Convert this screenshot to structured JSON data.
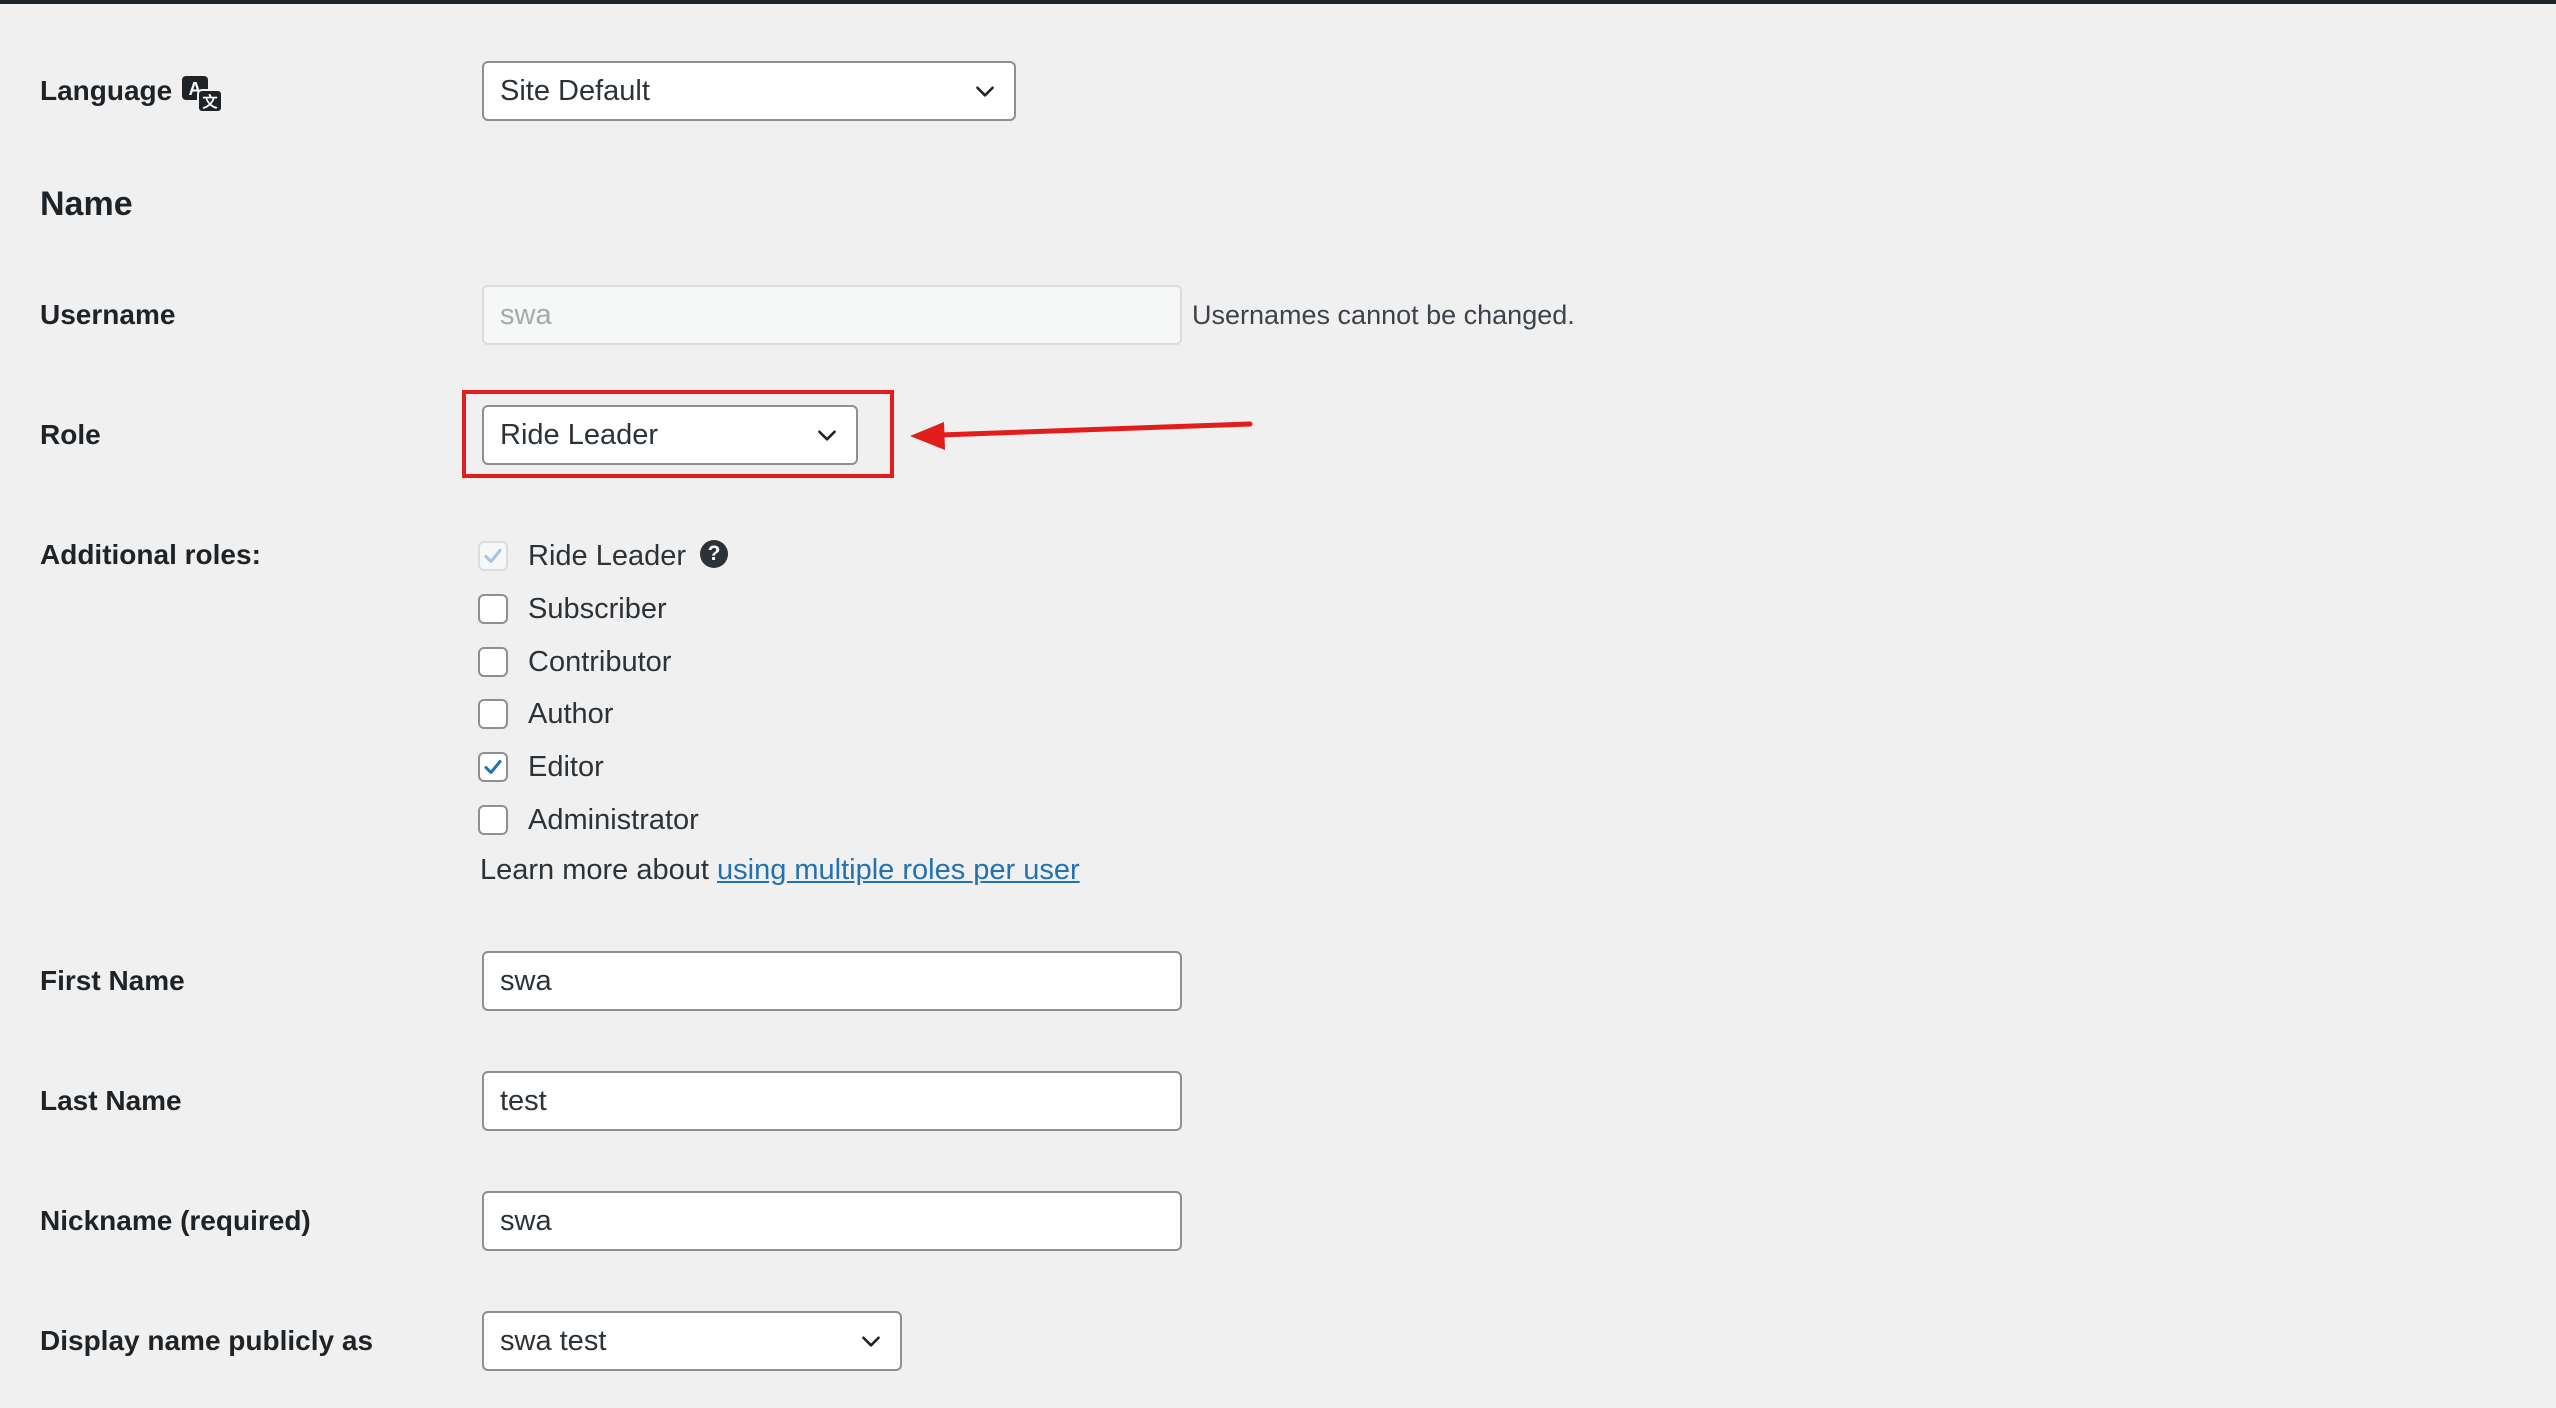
{
  "language": {
    "label": "Language",
    "icon": "translate-icon",
    "selected": "Site Default"
  },
  "name_section": {
    "title": "Name"
  },
  "username": {
    "label": "Username",
    "value": "swa",
    "description": "Usernames cannot be changed."
  },
  "role": {
    "label": "Role",
    "selected": "Ride Leader"
  },
  "additional_roles": {
    "label": "Additional roles:",
    "items": [
      {
        "label": "Ride Leader",
        "checked": true,
        "disabled": true,
        "help": "?"
      },
      {
        "label": "Subscriber",
        "checked": false
      },
      {
        "label": "Contributor",
        "checked": false
      },
      {
        "label": "Author",
        "checked": false
      },
      {
        "label": "Editor",
        "checked": true
      },
      {
        "label": "Administrator",
        "checked": false
      }
    ],
    "learn_more_prefix": "Learn more about",
    "learn_more_link": "using multiple roles per user"
  },
  "first_name": {
    "label": "First Name",
    "value": "swa"
  },
  "last_name": {
    "label": "Last Name",
    "value": "test"
  },
  "nickname": {
    "label": "Nickname (required)",
    "value": "swa"
  },
  "display_name": {
    "label": "Display name publicly as",
    "selected": "swa test"
  },
  "colors": {
    "background": "#f0f0f1",
    "link": "#2271b1",
    "checkmark": "#2271b1",
    "annotation": "#e31c1c"
  }
}
